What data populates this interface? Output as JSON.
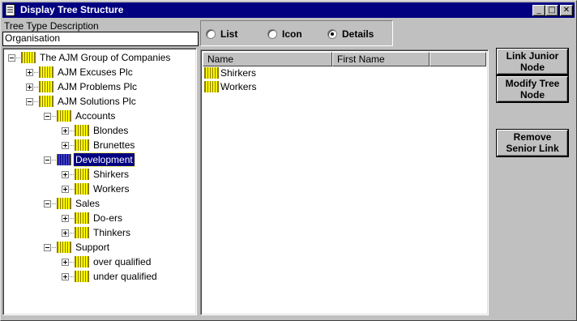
{
  "window": {
    "title": "Display Tree Structure",
    "min_glyph": "_",
    "max_glyph": "□",
    "close_glyph": "✕"
  },
  "tree_type": {
    "label": "Tree Type Description",
    "value": "Organisation"
  },
  "tree": [
    {
      "label": "The AJM Group of Companies",
      "level": 0,
      "expander": "minus"
    },
    {
      "label": "AJM Excuses Plc",
      "level": 1,
      "expander": "plus"
    },
    {
      "label": "AJM Problems Plc",
      "level": 1,
      "expander": "plus"
    },
    {
      "label": "AJM Solutions Plc",
      "level": 1,
      "expander": "minus"
    },
    {
      "label": "Accounts",
      "level": 2,
      "expander": "minus"
    },
    {
      "label": "Blondes",
      "level": 3,
      "expander": "plus"
    },
    {
      "label": "Brunettes",
      "level": 3,
      "expander": "plus"
    },
    {
      "label": "Development",
      "level": 2,
      "expander": "minus",
      "selected": true
    },
    {
      "label": "Shirkers",
      "level": 3,
      "expander": "plus"
    },
    {
      "label": "Workers",
      "level": 3,
      "expander": "plus"
    },
    {
      "label": "Sales",
      "level": 2,
      "expander": "minus"
    },
    {
      "label": "Do-ers",
      "level": 3,
      "expander": "plus"
    },
    {
      "label": "Thinkers",
      "level": 3,
      "expander": "plus"
    },
    {
      "label": "Support",
      "level": 2,
      "expander": "minus"
    },
    {
      "label": "over qualified",
      "level": 3,
      "expander": "plus"
    },
    {
      "label": "under qualified",
      "level": 3,
      "expander": "plus"
    }
  ],
  "view_options": {
    "list": "List",
    "icon": "Icon",
    "details": "Details",
    "selected": "details"
  },
  "list_view": {
    "columns": [
      "Name",
      "First Name"
    ],
    "items": [
      "Shirkers",
      "Workers"
    ]
  },
  "buttons": {
    "link_junior": [
      "Link Junior",
      "Node"
    ],
    "modify_tree": [
      "Modify Tree",
      "Node"
    ],
    "remove_senior": [
      "Remove",
      "Senior Link"
    ]
  },
  "colors": {
    "titlebar": "#000080",
    "face": "#c0c0c0",
    "selection": "#000080",
    "node_icon": "#ffff00"
  }
}
